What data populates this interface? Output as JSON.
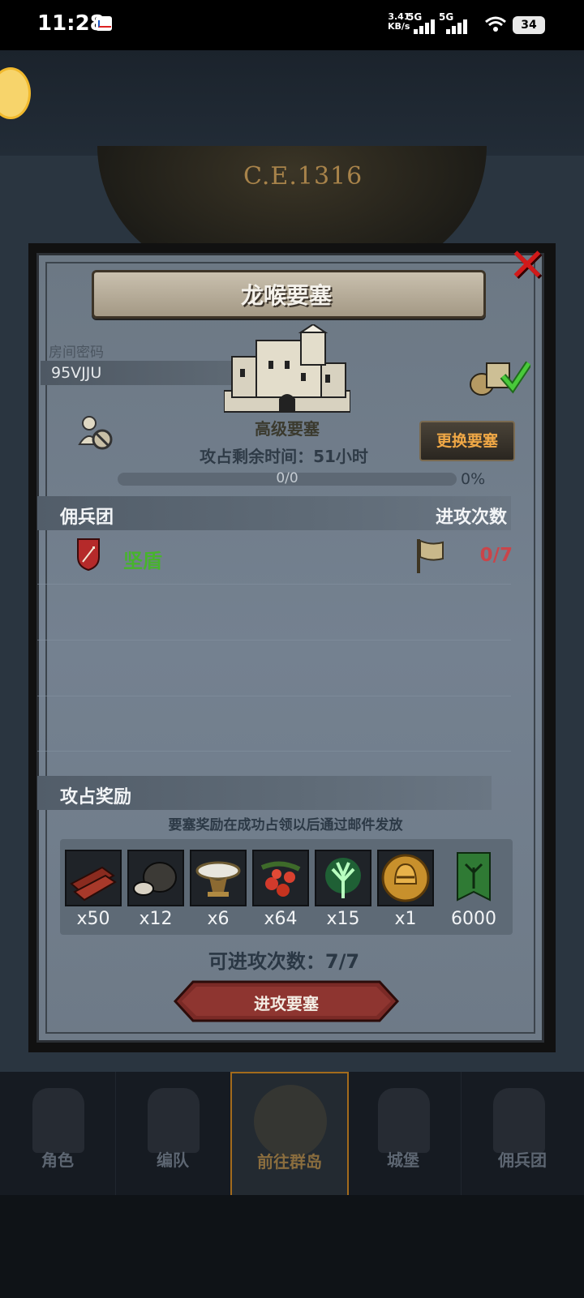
{
  "status_bar": {
    "time": "11:28",
    "net_speed_value": "3.41",
    "net_speed_unit": "KB/s",
    "net_type_1": "5G",
    "net_type_2": "5G",
    "battery": "34"
  },
  "background": {
    "year": "C.E.1316"
  },
  "dialog": {
    "title": "龙喉要塞",
    "room_password_label": "房间密码",
    "room_password": "95VJJU",
    "fortress_name": "高级要塞",
    "change_button": "更换要塞",
    "time_left": "攻占剩余时间：51小时",
    "progress_text": "0/0",
    "progress_percent": "0%",
    "progress_value": 0,
    "section_mercenary": "佣兵团",
    "section_attacks": "进攻次数",
    "mercenary": {
      "name": "坚盾",
      "attacks": "0/7"
    },
    "rewards_title": "攻占奖励",
    "rewards_note": "要塞奖励在成功占领以后通过邮件发放",
    "rewards": [
      {
        "icon": "wood-logs-icon",
        "qty": "x50"
      },
      {
        "icon": "truffle-icon",
        "qty": "x12"
      },
      {
        "icon": "silver-dish-icon",
        "qty": "x6"
      },
      {
        "icon": "berries-icon",
        "qty": "x64"
      },
      {
        "icon": "green-tree-emblem-icon",
        "qty": "x15"
      },
      {
        "icon": "golden-helmet-coin-icon",
        "qty": "x1"
      },
      {
        "icon": "green-banner-icon",
        "qty": "6000"
      }
    ],
    "attacks_available": "可进攻次数：7/7",
    "attack_button": "进攻要塞"
  },
  "bottom_nav": [
    "角色",
    "编队",
    "前往群岛",
    "城堡",
    "佣兵团"
  ],
  "colors": {
    "merc_green": "#47b42c",
    "attack_red": "#c9454a",
    "change_orange": "#f0a846",
    "close_red": "#d11a1a"
  }
}
